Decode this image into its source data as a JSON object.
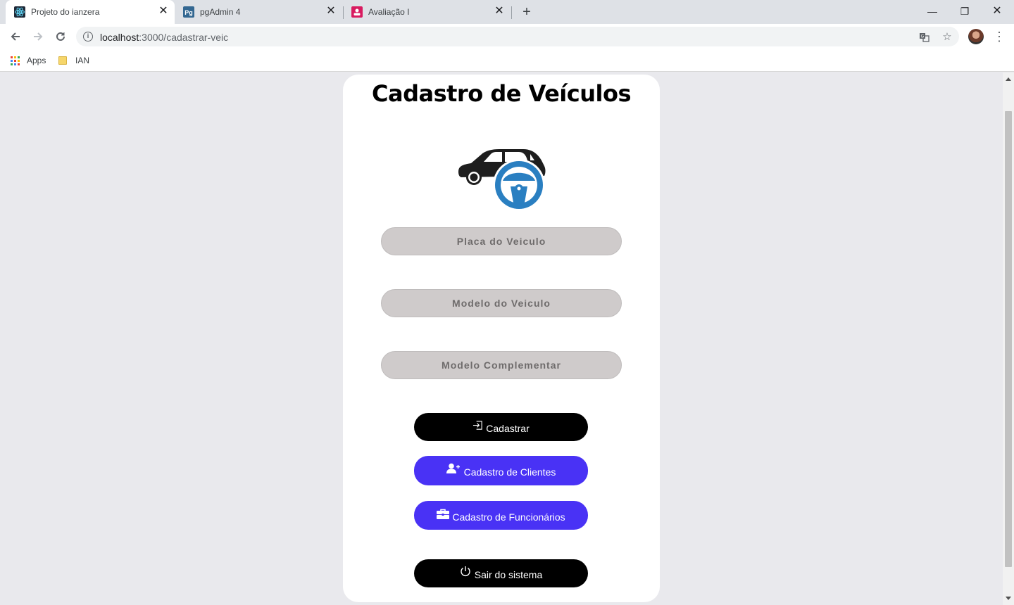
{
  "browser": {
    "tabs": [
      {
        "title": "Projeto do ianzera",
        "icon": "react-icon",
        "active": true
      },
      {
        "title": "pgAdmin 4",
        "icon": "pgadmin-icon",
        "active": false
      },
      {
        "title": "Avaliação I",
        "icon": "classroom-icon",
        "active": false
      }
    ],
    "url_host": "localhost",
    "url_path": ":3000/cadastrar-veic",
    "bookmarks": [
      {
        "label": "Apps",
        "icon": "apps-grid-icon"
      },
      {
        "label": "IAN",
        "icon": "folder-icon"
      }
    ]
  },
  "page": {
    "title": "Cadastro de Veículos",
    "logo_icon": "car-steering-wheel-icon",
    "fields": [
      {
        "name": "placa",
        "placeholder": "Placa do Veiculo",
        "value": ""
      },
      {
        "name": "modelo",
        "placeholder": "Modelo do Veiculo",
        "value": ""
      },
      {
        "name": "complementar",
        "placeholder": "Modelo Complementar",
        "value": ""
      }
    ],
    "buttons": {
      "cadastrar": {
        "label": "Cadastrar",
        "icon": "sign-in-icon"
      },
      "clientes": {
        "label": "Cadastro de Clientes",
        "icon": "user-plus-icon"
      },
      "funcionarios": {
        "label": "Cadastro de Funcionários",
        "icon": "briefcase-icon"
      },
      "sair": {
        "label": "Sair do sistema",
        "icon": "power-icon"
      }
    }
  },
  "colors": {
    "primary_button": "#4932f5",
    "dark_button": "#000000",
    "field_bg": "#cfcbcb",
    "page_bg": "#e9e9ed",
    "logo_blue": "#2a7fc1"
  }
}
